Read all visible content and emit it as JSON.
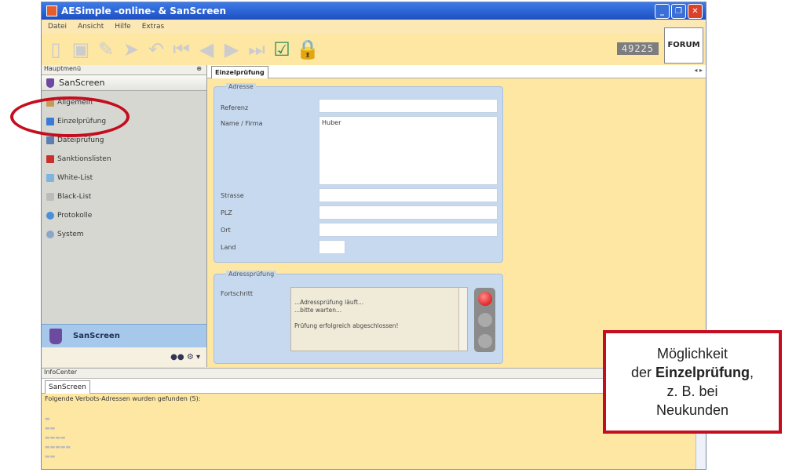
{
  "window": {
    "title": "AESimple -online- & SanScreen"
  },
  "menubar": {
    "items": [
      "Datei",
      "Ansicht",
      "Hilfe",
      "Extras"
    ]
  },
  "toolbar": {
    "counter": "49225",
    "logo": "FORUM"
  },
  "sidebar": {
    "header": "Hauptmenü",
    "pin": "⊕",
    "section_title": "SanScreen",
    "items": [
      {
        "label": "Allgemein"
      },
      {
        "label": "Einzelprüfung"
      },
      {
        "label": "Dateiprüfung"
      },
      {
        "label": "Sanktionslisten"
      },
      {
        "label": "White-List"
      },
      {
        "label": "Black-List"
      },
      {
        "label": "Protokolle"
      },
      {
        "label": "System"
      }
    ],
    "footer_title": "SanScreen"
  },
  "main": {
    "tab": "Einzelprüfung",
    "adresse": {
      "title": "Adresse",
      "referenz_label": "Referenz",
      "name_label": "Name / Firma",
      "name_value": "Huber",
      "strasse_label": "Strasse",
      "plz_label": "PLZ",
      "ort_label": "Ort",
      "land_label": "Land"
    },
    "adresspruefung": {
      "title": "Adressprüfung",
      "fortschritt_label": "Fortschritt",
      "progress_text": "...Adressprüfung läuft...\n...bitte warten...\n\nPrüfung erfolgreich abgeschlossen!"
    }
  },
  "infocenter": {
    "header": "InfoCenter",
    "tab": "SanScreen",
    "message": "Folgende Verbots-Adressen wurden gefunden (5):"
  },
  "callout": {
    "line1": "Möglichkeit",
    "line2_pre": "der ",
    "line2_bold": "Einzelprüfung",
    "line2_post": ",",
    "line3": "z. B. bei",
    "line4": "Neukunden"
  },
  "colors": {
    "highlight": "#c40d1e",
    "panel": "#c7d9ee",
    "window_bg": "#fde7a3"
  }
}
